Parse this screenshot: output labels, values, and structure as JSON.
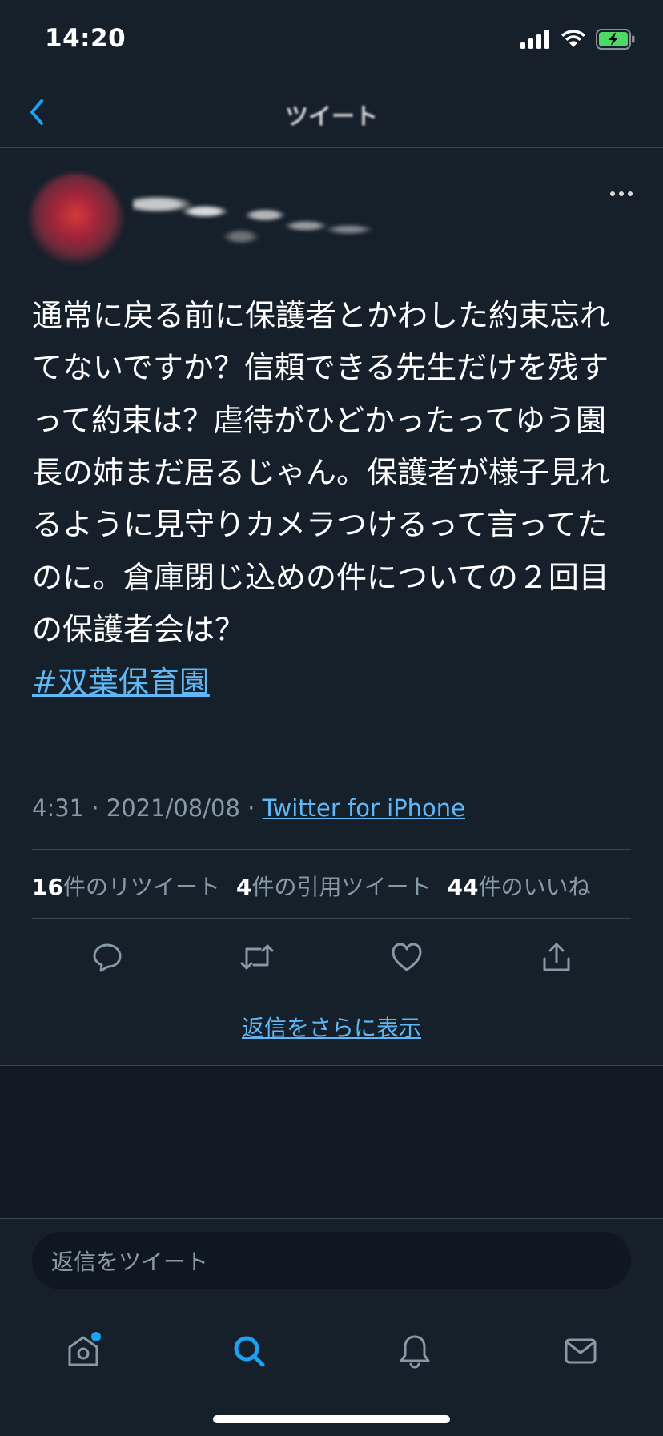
{
  "status_bar": {
    "time": "14:20",
    "icons": [
      "signal-icon",
      "wifi-icon",
      "battery-charging-icon"
    ]
  },
  "nav": {
    "title": "ツイート",
    "back_icon": "chevron-left-icon"
  },
  "tweet": {
    "text": "通常に戻る前に保護者とかわした約束忘れてないですか？信頼できる先生だけを残すって約束は？虐待がひどかったってゆう園長の姉まだ居るじゃん。保護者が様子見れるように見守りカメラつけるって言ってたのに。倉庫閉じ込めの件についての２回目の保護者会は？",
    "hashtag": "#双葉保育園",
    "time": "4:31",
    "separator": " · ",
    "date": "2021/08/08",
    "source": "Twitter for iPhone"
  },
  "stats": {
    "retweets_count": "16",
    "retweets_label": "件のリツイート",
    "quotes_count": "4",
    "quotes_label": "件の引用ツイート",
    "likes_count": "44",
    "likes_label": "件のいいね"
  },
  "actions": [
    "reply-icon",
    "retweet-icon",
    "like-icon",
    "share-icon"
  ],
  "more_replies": "返信をさらに表示",
  "reply_placeholder": "返信をツイート",
  "tabs": [
    "home-icon",
    "search-icon",
    "notifications-icon",
    "messages-icon"
  ],
  "colors": {
    "background": "#15202b",
    "accent": "#1da1f2",
    "link": "#5fb8f5",
    "secondary_text": "#8899a6",
    "divider": "#38444d"
  }
}
